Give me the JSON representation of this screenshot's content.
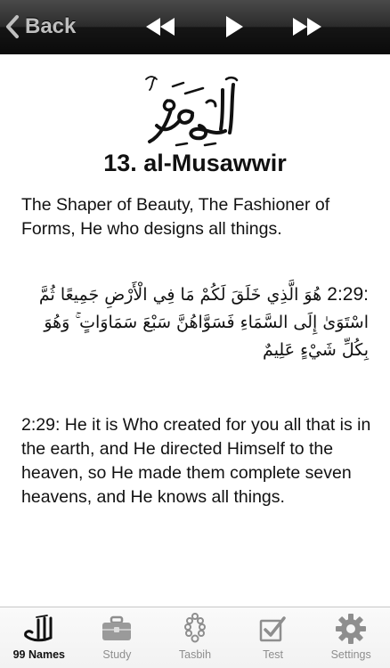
{
  "nav": {
    "back_label": "Back"
  },
  "name": {
    "number_title": "13. al-Musawwir",
    "meaning": "The Shaper of Beauty, The Fashioner of Forms, He who designs all things."
  },
  "verse": {
    "reference": "2:29:",
    "arabic": "هُوَ الَّذِي خَلَقَ لَكُمْ مَا فِي الْأَرْضِ جَمِيعًا ثُمَّ اسْتَوَىٰ إِلَى السَّمَاءِ فَسَوَّاهُنَّ سَبْعَ سَمَاوَاتٍ ۚ وَهُوَ بِكُلِّ شَيْءٍ عَلِيمٌ",
    "translation": "2:29: He it is Who created for you all that is in the earth, and He directed Himself to the heaven, so He made them complete seven heavens, and He knows all things."
  },
  "tabs": [
    {
      "label": "99 Names",
      "icon": "allah-calligraphy-icon",
      "active": true
    },
    {
      "label": "Study",
      "icon": "briefcase-icon",
      "active": false
    },
    {
      "label": "Tasbih",
      "icon": "prayer-beads-icon",
      "active": false
    },
    {
      "label": "Test",
      "icon": "checkbox-icon",
      "active": false
    },
    {
      "label": "Settings",
      "icon": "gear-icon",
      "active": false
    }
  ],
  "colors": {
    "toolbar_dark": "#151515",
    "toolbar_text": "#bfbfbf",
    "tab_inactive": "#8e8e8e",
    "tab_active": "#111111"
  }
}
